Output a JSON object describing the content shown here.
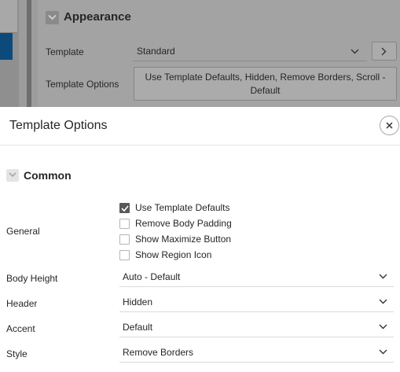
{
  "background": {
    "section_title": "Appearance",
    "template_label": "Template",
    "template_value": "Standard",
    "template_options_label": "Template Options",
    "template_options_value": "Use Template Defaults, Hidden, Remove Borders, Scroll - Default"
  },
  "dialog": {
    "title": "Template Options",
    "section_title": "Common",
    "general_label": "General",
    "checkboxes": [
      {
        "label": "Use Template Defaults",
        "checked": true
      },
      {
        "label": "Remove Body Padding",
        "checked": false
      },
      {
        "label": "Show Maximize Button",
        "checked": false
      },
      {
        "label": "Show Region Icon",
        "checked": false
      }
    ],
    "fields": [
      {
        "label": "Body Height",
        "value": "Auto - Default"
      },
      {
        "label": "Header",
        "value": "Hidden"
      },
      {
        "label": "Accent",
        "value": "Default"
      },
      {
        "label": "Style",
        "value": "Remove Borders"
      }
    ]
  }
}
